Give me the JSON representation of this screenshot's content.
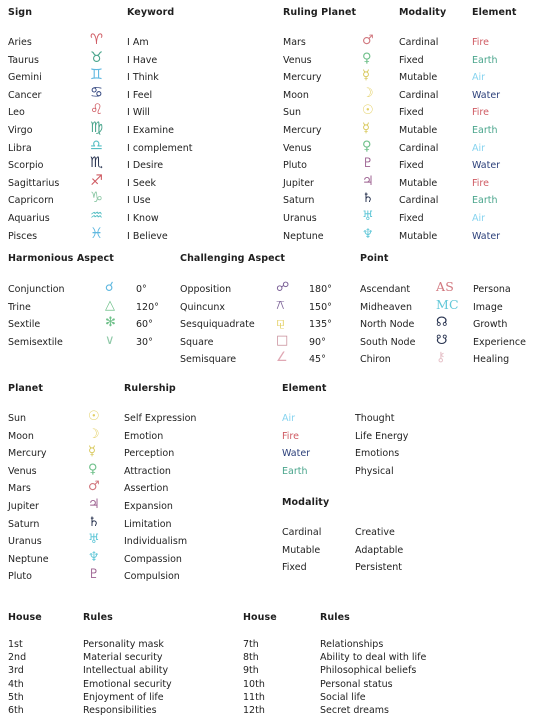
{
  "palette": {
    "fire": "#cf5b63",
    "earth": "#4aa58c",
    "air": "#86d3ef",
    "water": "#2b3f7a",
    "background": "#ffffff",
    "text": "#1f1f1f",
    "heading": "#111111"
  },
  "sections": {
    "signs": {
      "headers": {
        "sign": "Sign",
        "keyword": "Keyword",
        "ruling_planet": "Ruling Planet",
        "modality": "Modality",
        "element": "Element"
      },
      "rows": [
        {
          "sign": "Aries",
          "sign_glyph": "♈",
          "sign_color": "fire",
          "keyword": "I Am",
          "planet": "Mars",
          "planet_glyph": "♂",
          "planet_color": "salmon",
          "modality": "Cardinal",
          "element": "Fire",
          "element_color": "fire"
        },
        {
          "sign": "Taurus",
          "sign_glyph": "♉",
          "sign_color": "earth",
          "keyword": "I Have",
          "planet": "Venus",
          "planet_glyph": "♀",
          "planet_color": "green",
          "modality": "Fixed",
          "element": "Earth",
          "element_color": "earth"
        },
        {
          "sign": "Gemini",
          "sign_glyph": "♊",
          "sign_color": "blue",
          "keyword": "I Think",
          "planet": "Mercury",
          "planet_glyph": "☿",
          "planet_color": "yellow",
          "modality": "Mutable",
          "element": "Air",
          "element_color": "air"
        },
        {
          "sign": "Cancer",
          "sign_glyph": "♋",
          "sign_color": "water",
          "keyword": "I Feel",
          "planet": "Moon",
          "planet_glyph": "☽",
          "planet_color": "gold",
          "modality": "Cardinal",
          "element": "Water",
          "element_color": "water"
        },
        {
          "sign": "Leo",
          "sign_glyph": "♌",
          "sign_color": "fire",
          "keyword": "I Will",
          "planet": "Sun",
          "planet_glyph": "☉",
          "planet_color": "gold",
          "modality": "Fixed",
          "element": "Fire",
          "element_color": "fire"
        },
        {
          "sign": "Virgo",
          "sign_glyph": "♍",
          "sign_color": "earth",
          "keyword": "I Examine",
          "planet": "Mercury",
          "planet_glyph": "☿",
          "planet_color": "yellow",
          "modality": "Mutable",
          "element": "Earth",
          "element_color": "earth"
        },
        {
          "sign": "Libra",
          "sign_glyph": "♎",
          "sign_color": "teal",
          "keyword": "I complement",
          "planet": "Venus",
          "planet_glyph": "♀",
          "planet_color": "green",
          "modality": "Cardinal",
          "element": "Air",
          "element_color": "air"
        },
        {
          "sign": "Scorpio",
          "sign_glyph": "♏",
          "sign_color": "dark",
          "keyword": "I Desire",
          "planet": "Pluto",
          "planet_glyph": "♇",
          "planet_color": "plum",
          "modality": "Fixed",
          "element": "Water",
          "element_color": "water"
        },
        {
          "sign": "Sagittarius",
          "sign_glyph": "♐",
          "sign_color": "fire",
          "keyword": "I Seek",
          "planet": "Jupiter",
          "planet_glyph": "♃",
          "planet_color": "plum",
          "modality": "Mutable",
          "element": "Fire",
          "element_color": "fire"
        },
        {
          "sign": "Capricorn",
          "sign_glyph": "♑",
          "sign_color": "sage",
          "keyword": "I Use",
          "planet": "Saturn",
          "planet_glyph": "♄",
          "planet_color": "dark",
          "modality": "Cardinal",
          "element": "Earth",
          "element_color": "earth"
        },
        {
          "sign": "Aquarius",
          "sign_glyph": "♒",
          "sign_color": "teal",
          "keyword": "I Know",
          "planet": "Uranus",
          "planet_glyph": "♅",
          "planet_color": "cyan",
          "modality": "Fixed",
          "element": "Air",
          "element_color": "air"
        },
        {
          "sign": "Pisces",
          "sign_glyph": "♓",
          "sign_color": "blue",
          "keyword": "I Believe",
          "planet": "Neptune",
          "planet_glyph": "♆",
          "planet_color": "cyan",
          "modality": "Mutable",
          "element": "Water",
          "element_color": "water"
        }
      ]
    },
    "aspects": {
      "headers": {
        "harmonious": "Harmonious Aspect",
        "challenging": "Challenging Aspect",
        "point": "Point"
      },
      "harmonious": [
        {
          "name": "Conjunction",
          "glyph": "☌",
          "color": "blue",
          "degrees": "0°"
        },
        {
          "name": "Trine",
          "glyph": "△",
          "color": "green",
          "degrees": "120°"
        },
        {
          "name": "Sextile",
          "glyph": "✻",
          "color": "green",
          "degrees": "60°"
        },
        {
          "name": "Semisextile",
          "glyph": "∨",
          "color": "sage",
          "degrees": "30°"
        }
      ],
      "challenging": [
        {
          "name": "Opposition",
          "glyph": "☍",
          "color": "violet",
          "degrees": "180°"
        },
        {
          "name": "Quincunx",
          "glyph": "⚻",
          "color": "violet",
          "degrees": "150°"
        },
        {
          "name": "Sesquiquadrate",
          "glyph": "⚼",
          "color": "gold",
          "degrees": "135°"
        },
        {
          "name": "Square",
          "glyph": "□",
          "color": "rose",
          "degrees": "90°"
        },
        {
          "name": "Semisquare",
          "glyph": "∠",
          "color": "pink",
          "degrees": "45°"
        }
      ],
      "points": [
        {
          "name": "Ascendant",
          "glyph": "AS",
          "color": "salmon",
          "meaning": "Persona"
        },
        {
          "name": "Midheaven",
          "glyph": "MC",
          "color": "cyan",
          "meaning": "Image"
        },
        {
          "name": "North Node",
          "glyph": "☊",
          "color": "dark",
          "meaning": "Growth"
        },
        {
          "name": "South Node",
          "glyph": "☋",
          "color": "dark",
          "meaning": "Experience"
        },
        {
          "name": "Chiron",
          "glyph": "⚷",
          "color": "faint",
          "meaning": "Healing"
        }
      ]
    },
    "planets": {
      "headers": {
        "planet": "Planet",
        "rulership": "Rulership",
        "element": "Element",
        "modality": "Modality"
      },
      "rows": [
        {
          "planet": "Sun",
          "glyph": "☉",
          "color": "gold",
          "rulership": "Self Expression"
        },
        {
          "planet": "Moon",
          "glyph": "☽",
          "color": "gold",
          "rulership": "Emotion"
        },
        {
          "planet": "Mercury",
          "glyph": "☿",
          "color": "yellow",
          "rulership": "Perception"
        },
        {
          "planet": "Venus",
          "glyph": "♀",
          "color": "green",
          "rulership": "Attraction"
        },
        {
          "planet": "Mars",
          "glyph": "♂",
          "color": "salmon",
          "rulership": "Assertion"
        },
        {
          "planet": "Jupiter",
          "glyph": "♃",
          "color": "plum",
          "rulership": "Expansion"
        },
        {
          "planet": "Saturn",
          "glyph": "♄",
          "color": "dark",
          "rulership": "Limitation"
        },
        {
          "planet": "Uranus",
          "glyph": "♅",
          "color": "cyan",
          "rulership": "Individualism"
        },
        {
          "planet": "Neptune",
          "glyph": "♆",
          "color": "cyan",
          "rulership": "Compassion"
        },
        {
          "planet": "Pluto",
          "glyph": "♇",
          "color": "plum",
          "rulership": "Compulsion"
        }
      ],
      "elements": [
        {
          "name": "Air",
          "color": "air",
          "meaning": "Thought"
        },
        {
          "name": "Fire",
          "color": "fire",
          "meaning": "Life Energy"
        },
        {
          "name": "Water",
          "color": "water",
          "meaning": "Emotions"
        },
        {
          "name": "Earth",
          "color": "earth",
          "meaning": "Physical"
        }
      ],
      "modalities": [
        {
          "name": "Cardinal",
          "meaning": "Creative"
        },
        {
          "name": "Mutable",
          "meaning": "Adaptable"
        },
        {
          "name": "Fixed",
          "meaning": "Persistent"
        }
      ]
    },
    "houses": {
      "headers": {
        "house_left": "House",
        "rules_left": "Rules",
        "house_right": "House",
        "rules_right": "Rules"
      },
      "left": [
        {
          "house": "1st",
          "rules": "Personality mask"
        },
        {
          "house": "2nd",
          "rules": "Material security"
        },
        {
          "house": "3rd",
          "rules": "Intellectual ability"
        },
        {
          "house": "4th",
          "rules": "Emotional security"
        },
        {
          "house": "5th",
          "rules": "Enjoyment of life"
        },
        {
          "house": "6th",
          "rules": "Responsibilities"
        }
      ],
      "right": [
        {
          "house": "7th",
          "rules": "Relationships"
        },
        {
          "house": "8th",
          "rules": "Ability to deal with life"
        },
        {
          "house": "9th",
          "rules": "Philosophical beliefs"
        },
        {
          "house": "10th",
          "rules": "Personal status"
        },
        {
          "house": "11th",
          "rules": "Social life"
        },
        {
          "house": "12th",
          "rules": "Secret dreams"
        }
      ]
    }
  }
}
